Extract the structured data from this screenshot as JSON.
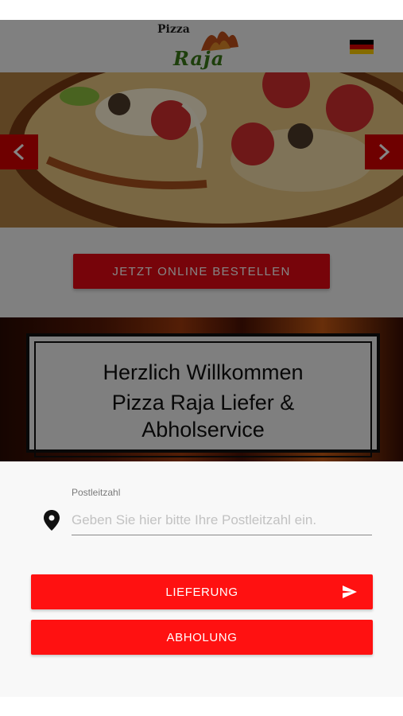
{
  "header": {
    "logo_top": "Pizza",
    "logo_bottom": "Raja",
    "language": "german-flag-icon"
  },
  "slider": {
    "prev_icon": "chevron-left-icon",
    "next_icon": "chevron-right-icon"
  },
  "cta": {
    "label": "JETZT ONLINE BESTELLEN"
  },
  "welcome": {
    "line1": "Herzlich Willkommen",
    "line2": "Pizza Raja Liefer &",
    "line3": "Abholservice"
  },
  "postal": {
    "label": "Postleitzahl",
    "placeholder": "Geben Sie hier bitte Ihre Postleitzahl ein.",
    "icon": "location-pin-icon"
  },
  "actions": {
    "delivery_label": "LIEFERUNG",
    "pickup_label": "ABHOLUNG",
    "delivery_icon": "send-icon"
  },
  "colors": {
    "primary_red": "#ff1111",
    "cta_red": "#e50914"
  }
}
